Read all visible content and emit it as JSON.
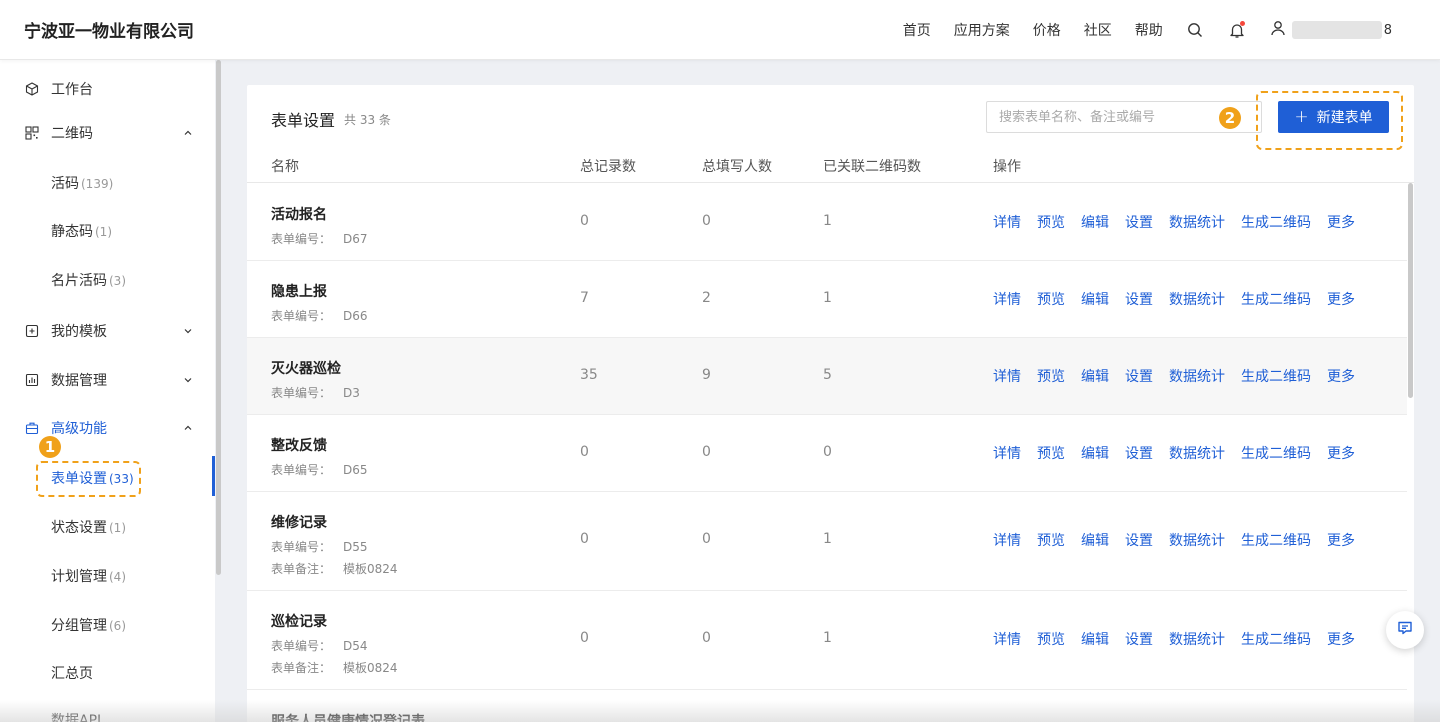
{
  "header": {
    "brand": "宁波亚一物业有限公司",
    "nav": [
      "首页",
      "应用方案",
      "价格",
      "社区",
      "帮助"
    ],
    "user_suffix": "8"
  },
  "sidebar": {
    "items": [
      {
        "label": "工作台",
        "icon": "cube-icon"
      },
      {
        "label": "二维码",
        "icon": "qrcode-icon",
        "expanded": true
      },
      {
        "label": "活码",
        "count": "(139)"
      },
      {
        "label": "静态码",
        "count": "(1)"
      },
      {
        "label": "名片活码",
        "count": "(3)"
      },
      {
        "label": "我的模板",
        "icon": "template-icon",
        "expanded": false
      },
      {
        "label": "数据管理",
        "icon": "chart-icon",
        "expanded": false
      },
      {
        "label": "高级功能",
        "icon": "briefcase-icon",
        "expanded": true
      },
      {
        "label": "表单设置",
        "count": "(33)",
        "active": true
      },
      {
        "label": "状态设置",
        "count": "(1)"
      },
      {
        "label": "计划管理",
        "count": "(4)"
      },
      {
        "label": "分组管理",
        "count": "(6)"
      },
      {
        "label": "汇总页"
      },
      {
        "label": "数据API"
      }
    ]
  },
  "badges": {
    "one": "1",
    "two": "2"
  },
  "panel": {
    "title": "表单设置",
    "count": "共 33 条",
    "search_placeholder": "搜索表单名称、备注或编号",
    "new_button": "新建表单",
    "columns": [
      "名称",
      "总记录数",
      "总填写人数",
      "已关联二维码数",
      "操作"
    ],
    "meta_labels": {
      "code": "表单编号：",
      "note": "表单备注："
    },
    "ops": [
      "详情",
      "预览",
      "编辑",
      "设置",
      "数据统计",
      "生成二维码",
      "更多"
    ],
    "rows": [
      {
        "name": "活动报名",
        "code": "D67",
        "note": "",
        "total": "0",
        "fill": "0",
        "qr": "1"
      },
      {
        "name": "隐患上报",
        "code": "D66",
        "note": "",
        "total": "7",
        "fill": "2",
        "qr": "1"
      },
      {
        "name": "灭火器巡检",
        "code": "D3",
        "note": "",
        "total": "35",
        "fill": "9",
        "qr": "5"
      },
      {
        "name": "整改反馈",
        "code": "D65",
        "note": "",
        "total": "0",
        "fill": "0",
        "qr": "0"
      },
      {
        "name": "维修记录",
        "code": "D55",
        "note": "模板0824",
        "total": "0",
        "fill": "0",
        "qr": "1"
      },
      {
        "name": "巡检记录",
        "code": "D54",
        "note": "模板0824",
        "total": "0",
        "fill": "0",
        "qr": "1"
      },
      {
        "name": "服务人员健康情况登记表",
        "code": "",
        "note": "",
        "total": "",
        "fill": "",
        "qr": ""
      }
    ]
  },
  "colors": {
    "accent": "#1f5fd6",
    "highlight": "#f0a11a"
  }
}
